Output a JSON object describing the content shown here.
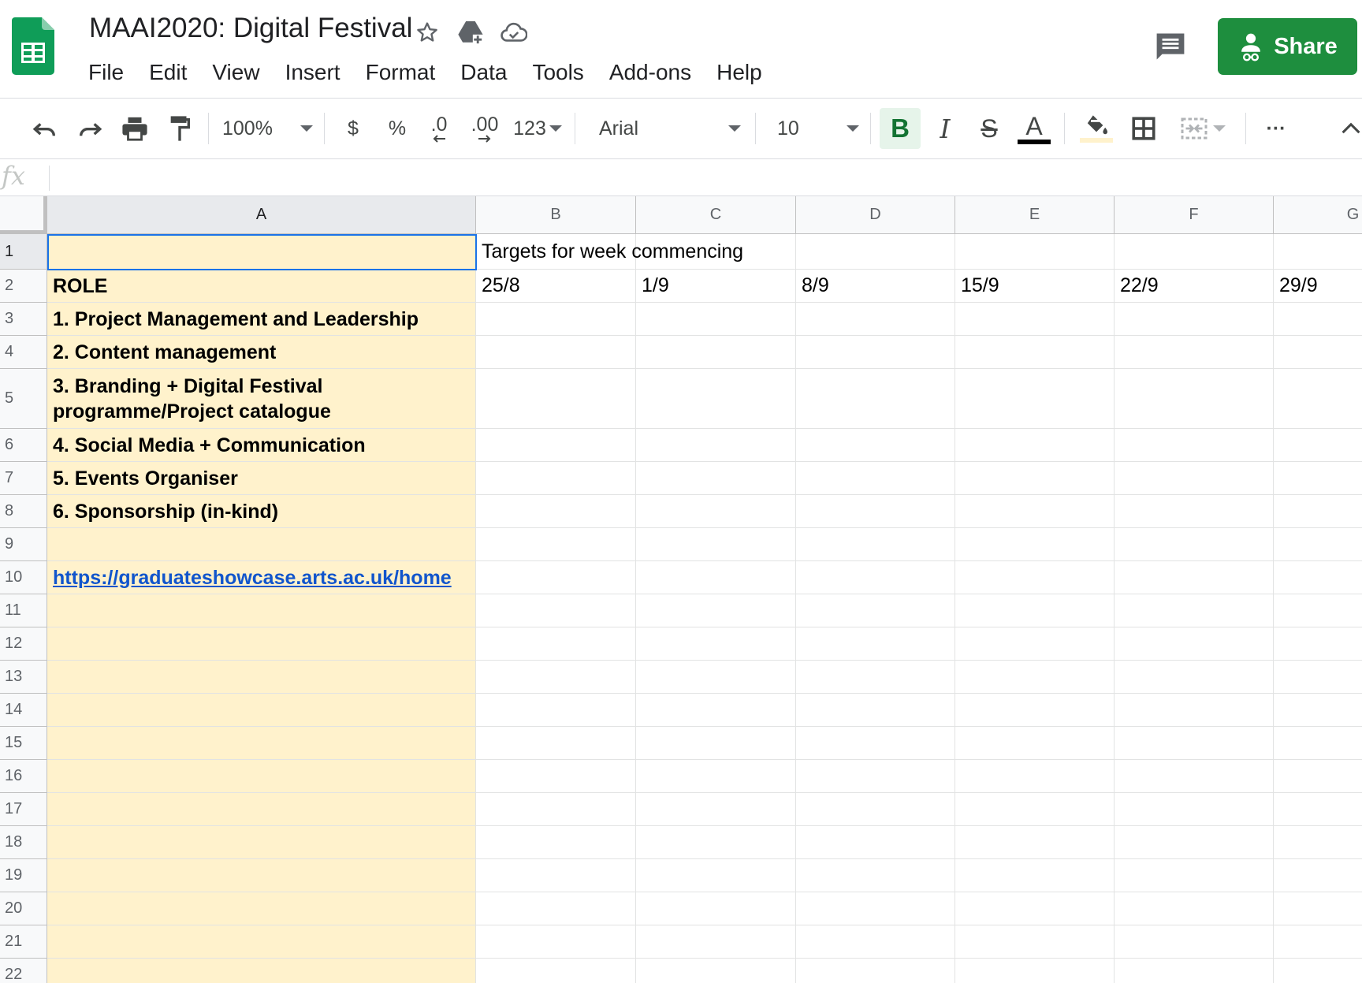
{
  "document": {
    "title": "MAAI2020: Digital Festival"
  },
  "menu": [
    "File",
    "Edit",
    "View",
    "Insert",
    "Format",
    "Data",
    "Tools",
    "Add-ons",
    "Help"
  ],
  "share_label": "Share",
  "toolbar": {
    "zoom": "100%",
    "currency": "$",
    "percent": "%",
    "decrease_decimal": ".0",
    "increase_decimal": ".00",
    "more_formats": "123",
    "font": "Arial",
    "font_size": "10",
    "bold": "B",
    "italic": "I",
    "strike": "S",
    "text_color_letter": "A",
    "text_color": "#000000",
    "fill_color": "#fff2cc",
    "more": "···"
  },
  "formula_bar": {
    "label": "fx",
    "value": ""
  },
  "columns": [
    "A",
    "B",
    "C",
    "D",
    "E",
    "F",
    "G"
  ],
  "rows": [
    "1",
    "2",
    "3",
    "4",
    "5",
    "6",
    "7",
    "8",
    "9",
    "10",
    "11",
    "12",
    "13",
    "14",
    "15",
    "16",
    "17",
    "18",
    "19",
    "20",
    "21",
    "22"
  ],
  "cells": {
    "A2": "ROLE",
    "A3": "1. Project Management and Leadership",
    "A4": "2. Content management",
    "A5": "3. Branding + Digital Festival programme/Project catalogue",
    "A6": "4. Social Media + Communication",
    "A7": "5. Events Organiser",
    "A8": "6. Sponsorship (in-kind)",
    "A10": "https://graduateshowcase.arts.ac.uk/home",
    "B1": "Targets for week commencing",
    "B2": "25/8",
    "C2": "1/9",
    "D2": "8/9",
    "E2": "15/9",
    "F2": "22/9",
    "G2": "29/9"
  },
  "active_cell": "A1",
  "colors": {
    "share_green": "#1e8e3e",
    "column_a_fill": "#fff2cc",
    "link": "#1155cc",
    "selection": "#1a73e8"
  }
}
